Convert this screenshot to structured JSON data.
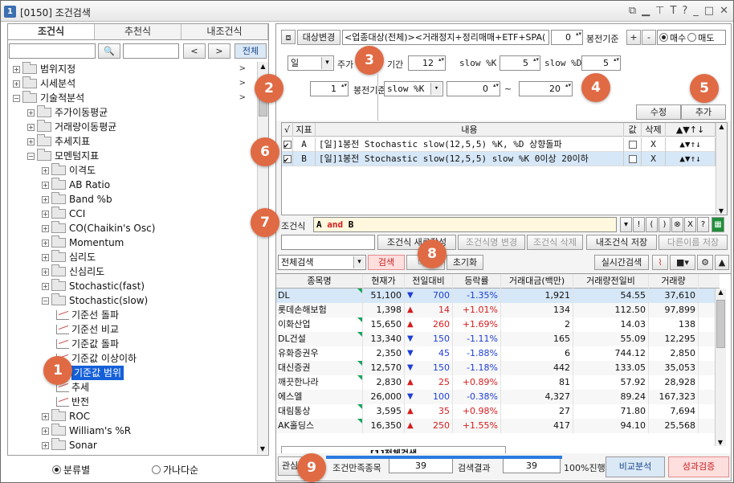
{
  "window": {
    "title": "[0150] 조건검색",
    "icon_label": "1",
    "controls": [
      "restore-icon",
      "minimize-icon",
      "pin-icon",
      "font-icon",
      "help-icon",
      "min-icon",
      "max-icon",
      "close-icon"
    ]
  },
  "left": {
    "tabs": [
      {
        "label": "조건식",
        "active": true
      },
      {
        "label": "추천식"
      },
      {
        "label": "내조건식"
      }
    ],
    "nav_prev": "<",
    "nav_next": ">",
    "all_label": "전체",
    "tree": [
      {
        "label": "범위지정",
        "arrow": ">",
        "level": 0
      },
      {
        "label": "시세분석",
        "arrow": ">",
        "level": 0
      },
      {
        "label": "기술적분석",
        "arrow": ">",
        "level": 0,
        "open": true
      },
      {
        "label": "주가이동평균",
        "level": 1
      },
      {
        "label": "거래량이동평균",
        "level": 1
      },
      {
        "label": "추세지표",
        "level": 1
      },
      {
        "label": "모멘텀지표",
        "level": 1,
        "open": true
      },
      {
        "label": "이격도",
        "level": 2
      },
      {
        "label": "AB Ratio",
        "level": 2
      },
      {
        "label": "Band %b",
        "level": 2
      },
      {
        "label": "CCI",
        "level": 2
      },
      {
        "label": "CO(Chaikin's Osc)",
        "level": 2
      },
      {
        "label": "Momentum",
        "level": 2
      },
      {
        "label": "심리도",
        "level": 2
      },
      {
        "label": "신심리도",
        "level": 2
      },
      {
        "label": "Stochastic(fast)",
        "level": 2
      },
      {
        "label": "Stochastic(slow)",
        "level": 2,
        "open": true
      },
      {
        "label": "기준선 돌파",
        "level": 3,
        "leaf": true
      },
      {
        "label": "기준선 비교",
        "level": 3,
        "leaf": true
      },
      {
        "label": "기준값 돌파",
        "level": 3,
        "leaf": true
      },
      {
        "label": "기준값 이상이하",
        "level": 3,
        "leaf": true
      },
      {
        "label": "기준값 범위",
        "level": 3,
        "leaf": true,
        "selected": true
      },
      {
        "label": "추세",
        "level": 3,
        "leaf": true
      },
      {
        "label": "반전",
        "level": 3,
        "leaf": true
      },
      {
        "label": "ROC",
        "level": 2
      },
      {
        "label": "William's %R",
        "level": 2
      },
      {
        "label": "Sonar",
        "level": 2
      }
    ],
    "radio": [
      {
        "label": "분류별",
        "on": true
      },
      {
        "label": "가나다순",
        "on": false
      }
    ]
  },
  "cfg": {
    "target_btn": "대상변경",
    "target_text": "<업종대상(전체)><거래정지+정리매매+ETF+SPA(",
    "bong_val": "0",
    "bong_label": "봉전기준",
    "plus": "+",
    "minus": "-",
    "buy": "매수",
    "sell": "매도",
    "period_sel": "일",
    "ju_label": "주가",
    "gigan_label": "기간",
    "gigan_val": "12",
    "slowk_label": "slow %K",
    "slowk_val": "5",
    "slowd_label": "slow %D",
    "slowd_val": "5",
    "bong2_val": "1",
    "bong2_label": "봉전기준",
    "ind_sel": "slow %K",
    "range_from": "0",
    "tilde": "~",
    "range_to": "20",
    "edit_btn": "수정",
    "add_btn": "추가"
  },
  "grid": {
    "headers": [
      "√",
      "지표",
      "내용",
      "값",
      "삭제",
      "▲▼↑↓"
    ],
    "rows": [
      {
        "checked": true,
        "id": "A",
        "content": "[일]1봉전 Stochastic slow(12,5,5) %K, %D 상향돌파",
        "del": "X",
        "move": "▲▼↑↓"
      },
      {
        "checked": true,
        "id": "B",
        "content": "[일]1봉전 Stochastic slow(12,5,5) slow %K 0이상 20이하",
        "del": "X",
        "move": "▲▼↑↓",
        "hl": true
      }
    ]
  },
  "formula": {
    "label": "조건식",
    "expr": "A and B",
    "ops": [
      "▾",
      "!",
      "(",
      ")",
      "⊗",
      "X",
      "?"
    ]
  },
  "savebar": {
    "new_btn": "조건식 새로작성",
    "rename_btn": "조건식명 변경",
    "delete_btn": "조건식 삭제",
    "save_btn": "내조건식 저장",
    "saveas_btn": "다른이름 저장"
  },
  "searchbar": {
    "scope": "전체검색",
    "search_btn": "검색",
    "next_btn": "다음",
    "reset_btn": "초기화",
    "realtime_btn": "실시간검색"
  },
  "results": {
    "headers": [
      "종목명",
      "현재가",
      "전일대비",
      "등락률",
      "거래대금(백만)",
      "거래량전일비",
      "거래량"
    ],
    "rows": [
      {
        "name": "DL",
        "price": "51,100",
        "dir": "dn",
        "chg": "700",
        "rate": "-1.35%",
        "amt": "1,921",
        "ratio": "54.55",
        "vol": "37,610",
        "hl": true,
        "tri": true
      },
      {
        "name": "롯데손해보험",
        "price": "1,398",
        "dir": "up",
        "chg": "14",
        "rate": "+1.01%",
        "amt": "134",
        "ratio": "112.50",
        "vol": "97,899"
      },
      {
        "name": "이화산업",
        "price": "15,650",
        "dir": "up",
        "chg": "260",
        "rate": "+1.69%",
        "amt": "2",
        "ratio": "14.03",
        "vol": "138",
        "tri": true
      },
      {
        "name": "DL건설",
        "price": "13,340",
        "dir": "dn",
        "chg": "150",
        "rate": "-1.11%",
        "amt": "165",
        "ratio": "55.09",
        "vol": "12,295",
        "tri": true
      },
      {
        "name": "유화증권우",
        "price": "2,350",
        "dir": "dn",
        "chg": "45",
        "rate": "-1.88%",
        "amt": "6",
        "ratio": "744.12",
        "vol": "2,850"
      },
      {
        "name": "대신증권",
        "price": "12,570",
        "dir": "dn",
        "chg": "150",
        "rate": "-1.18%",
        "amt": "442",
        "ratio": "133.05",
        "vol": "35,053",
        "tri": true
      },
      {
        "name": "깨끗한나라",
        "price": "2,830",
        "dir": "up",
        "chg": "25",
        "rate": "+0.89%",
        "amt": "81",
        "ratio": "57.92",
        "vol": "28,928",
        "tri": true
      },
      {
        "name": "에스엘",
        "price": "26,000",
        "dir": "dn",
        "chg": "100",
        "rate": "-0.38%",
        "amt": "4,327",
        "ratio": "89.24",
        "vol": "167,323"
      },
      {
        "name": "대림통상",
        "price": "3,595",
        "dir": "up",
        "chg": "35",
        "rate": "+0.98%",
        "amt": "27",
        "ratio": "71.80",
        "vol": "7,694",
        "tri": true
      },
      {
        "name": "AK홀딩스",
        "price": "16,350",
        "dir": "up",
        "chg": "250",
        "rate": "+1.55%",
        "amt": "417",
        "ratio": "94.10",
        "vol": "25,568",
        "tri": true
      }
    ],
    "tab": "[1]전체검색"
  },
  "status": {
    "left_label": "관심",
    "count_label": "조건만족종목",
    "count_val": "39",
    "result_label": "검색결과",
    "result_val": "39",
    "progress_text": "100%진행",
    "progress": 1.0,
    "compare_btn": "비교분석",
    "verify_btn": "성과검증"
  },
  "badges": [
    "1",
    "2",
    "3",
    "4",
    "5",
    "6",
    "7",
    "8",
    "9"
  ],
  "colors": {
    "up": "#d61c1c",
    "down": "#1e3fd6",
    "select": "#1560d9",
    "badge": "#e06a44",
    "formula_bg": "#fff8de",
    "highlight_row": "#d6e7f7"
  }
}
